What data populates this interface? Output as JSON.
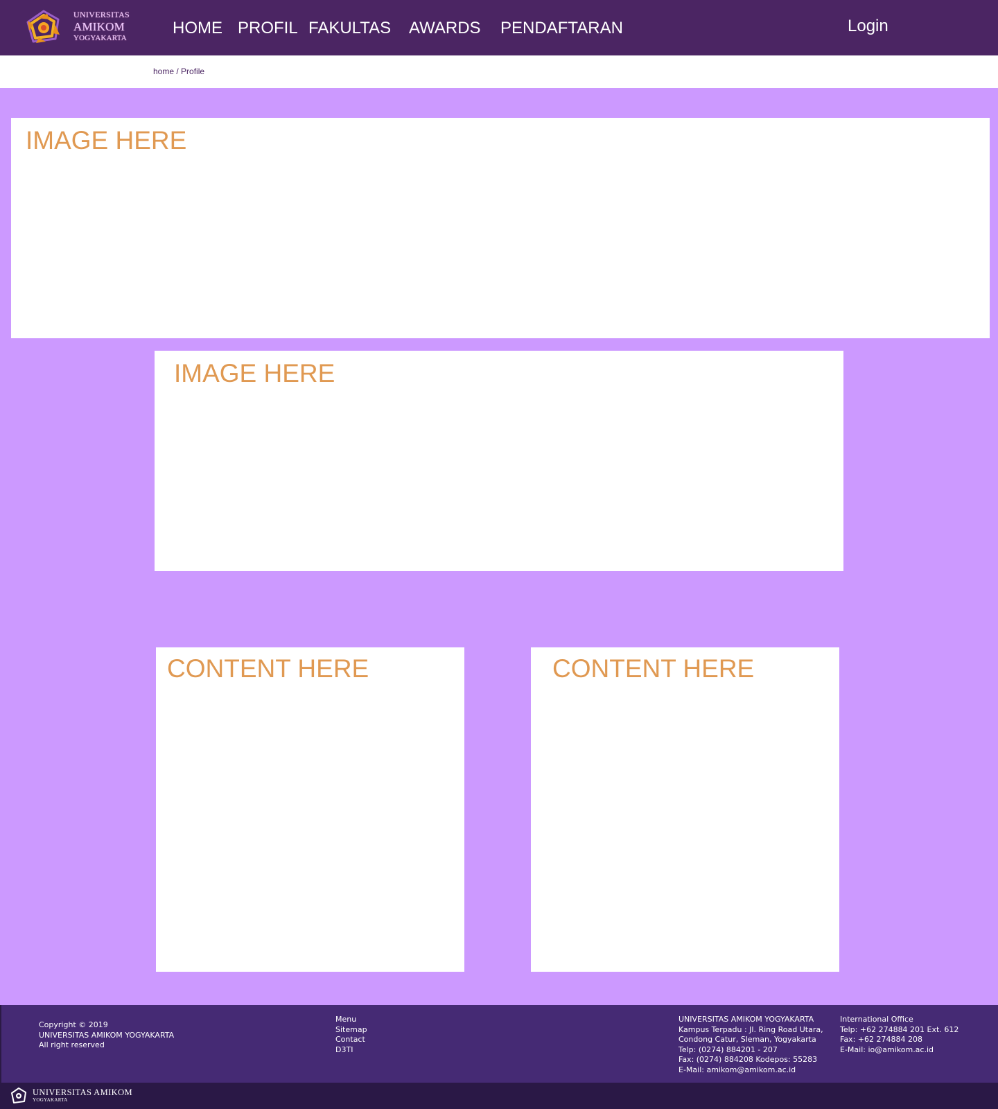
{
  "header": {
    "logo": {
      "line1": "UNIVERSITAS",
      "line2": "AMIKOM",
      "line3": "YOGYAKARTA"
    },
    "nav": [
      {
        "label": "HOME"
      },
      {
        "label": "PROFIL"
      },
      {
        "label": "FAKULTAS"
      },
      {
        "label": "AWARDS"
      },
      {
        "label": "PENDAFTARAN"
      }
    ],
    "login_label": "Login"
  },
  "breadcrumb": {
    "home": "home",
    "separator": " / ",
    "current": "Profile"
  },
  "main": {
    "hero1": "IMAGE HERE",
    "hero2": "IMAGE HERE",
    "card1": "CONTENT HERE",
    "card2": "CONTENT HERE"
  },
  "footer": {
    "copyright": [
      "Copyright © 2019",
      "UNIVERSITAS AMIKOM YOGYAKARTA",
      "All right reserved"
    ],
    "links": [
      "Menu",
      "Sitemap",
      "Contact",
      "D3TI"
    ],
    "address": [
      "UNIVERSITAS AMIKOM YOGYAKARTA",
      "Kampus Terpadu : Jl. Ring Road Utara,",
      "Condong Catur, Sleman, Yogyakarta",
      "Telp: (0274) 884201 - 207",
      "Fax: (0274) 884208 Kodepos: 55283",
      "E-Mail: amikom@amikom.ac.id"
    ],
    "international": [
      "International Office",
      "Telp: +62 274884 201 Ext. 612",
      "Fax: +62 274884 208",
      "E-Mail: io@amikom.ac.id"
    ],
    "bottom_logo": {
      "line1": "UNIVERSITAS AMIKOM",
      "line2": "YOGYAKARTA"
    }
  },
  "colors": {
    "header_bg": "#4b2563",
    "page_bg": "#cc99ff",
    "placeholder_text": "#e09952",
    "footer_bg": "#452a74",
    "subfooter_bg": "#2a1846"
  }
}
